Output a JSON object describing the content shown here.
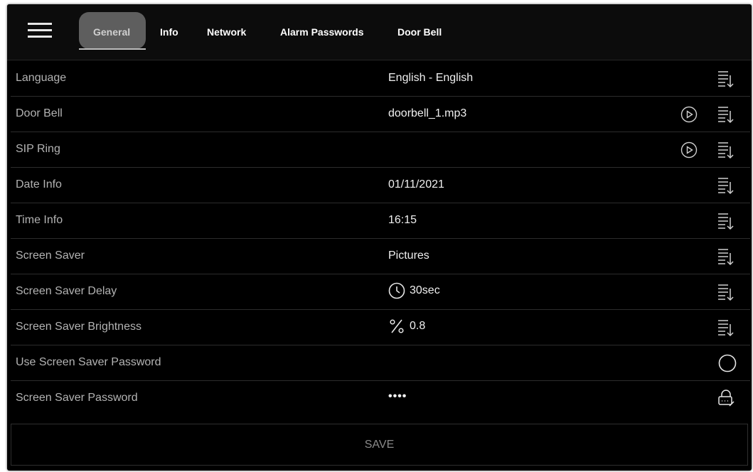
{
  "tabs": [
    {
      "label": "General",
      "active": true
    },
    {
      "label": "Info"
    },
    {
      "label": "Network"
    },
    {
      "label": "Alarm Passwords"
    },
    {
      "label": "Door Bell"
    }
  ],
  "settings": {
    "language": {
      "label": "Language",
      "value": "English - English"
    },
    "door_bell": {
      "label": "Door Bell",
      "value": "doorbell_1.mp3"
    },
    "sip_ring": {
      "label": "SIP Ring",
      "value": ""
    },
    "date_info": {
      "label": "Date Info",
      "value": "01/11/2021"
    },
    "time_info": {
      "label": "Time Info",
      "value": "16:15"
    },
    "screen_saver": {
      "label": "Screen Saver",
      "value": "Pictures"
    },
    "screen_saver_delay": {
      "label": "Screen Saver Delay",
      "value": "30sec",
      "icon": "clock-icon"
    },
    "screen_saver_brightness": {
      "label": "Screen Saver Brightness",
      "value": "0.8",
      "icon": "percent-icon"
    },
    "use_screen_saver_password": {
      "label": "Use Screen Saver Password",
      "checked": false
    },
    "screen_saver_password": {
      "label": "Screen Saver Password",
      "value": "••••"
    }
  },
  "save_label": "SAVE",
  "colors": {
    "background": "#000000",
    "active_tab": "#5e5e5e",
    "label_text": "#b3b3b3",
    "value_text": "#f0f0f0",
    "divider": "#2c2c2c"
  }
}
